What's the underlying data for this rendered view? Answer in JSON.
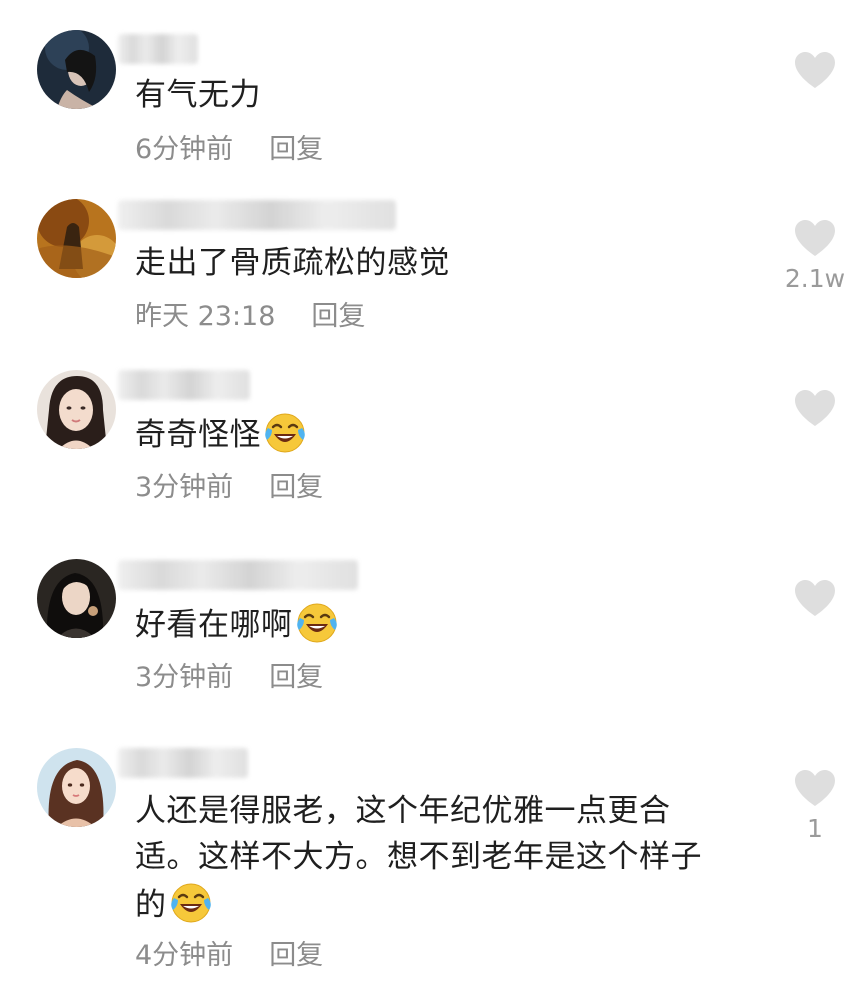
{
  "comments": [
    {
      "text": "有气无力",
      "time": "6分钟前",
      "reply_label": "回复",
      "like_count": "",
      "has_emoji": false
    },
    {
      "text": "走出了骨质疏松的感觉",
      "time": "昨天 23:18",
      "reply_label": "回复",
      "like_count": "2.1w",
      "has_emoji": false
    },
    {
      "text": "奇奇怪怪",
      "time": "3分钟前",
      "reply_label": "回复",
      "like_count": "",
      "has_emoji": true,
      "emoji": "laughing-crying-emoji"
    },
    {
      "text": "好看在哪啊",
      "time": "3分钟前",
      "reply_label": "回复",
      "like_count": "",
      "has_emoji": true,
      "emoji": "laughing-crying-emoji"
    },
    {
      "text_line1": "人还是得服老，这个年纪优雅一点更合",
      "text_line2": "适。这样不大方。想不到老年是这个样子",
      "text_line3": "的",
      "time": "4分钟前",
      "reply_label": "回复",
      "like_count": "1",
      "has_emoji": true,
      "emoji": "laughing-crying-emoji"
    }
  ],
  "icons": {
    "like": "heart-icon",
    "emoji": "laughing-crying-emoji"
  },
  "colors": {
    "text": "#1f1f1f",
    "meta": "#8c8c8c",
    "heart": "#dedede"
  }
}
